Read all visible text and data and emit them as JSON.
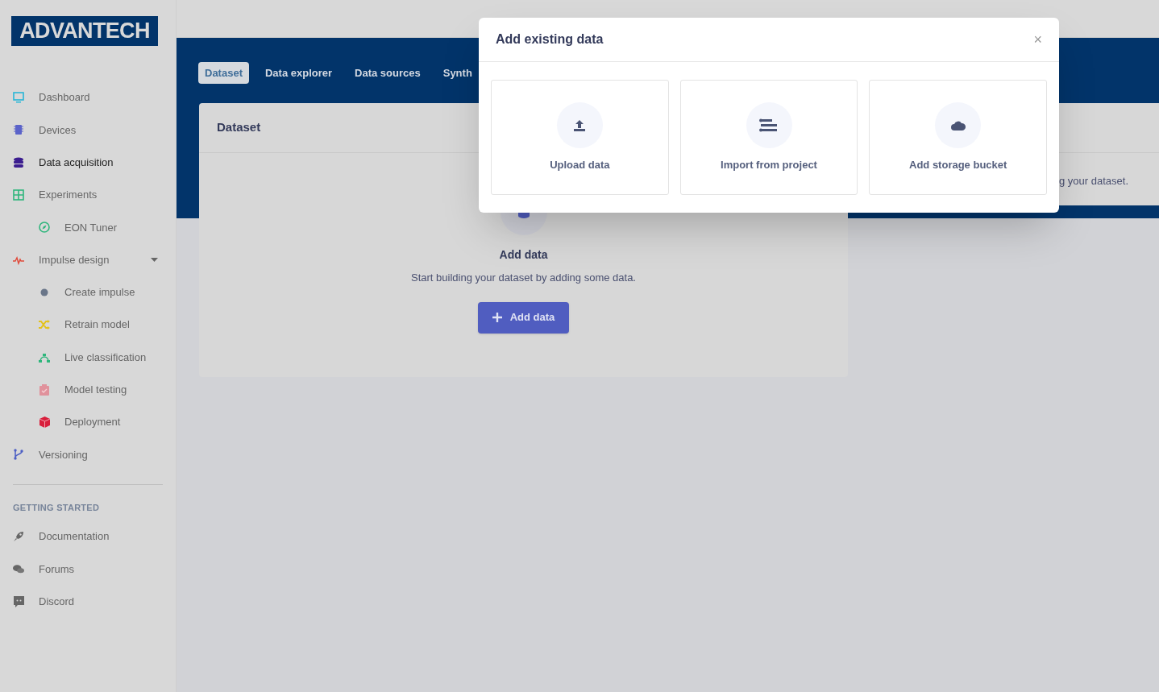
{
  "sidebar": {
    "logo": "ADVANTECH",
    "items": [
      {
        "label": "Dashboard",
        "kind": "main",
        "selected": false
      },
      {
        "label": "Devices",
        "kind": "main",
        "selected": false
      },
      {
        "label": "Data acquisition",
        "kind": "main",
        "selected": true
      },
      {
        "label": "Experiments",
        "kind": "main",
        "selected": false
      },
      {
        "label": "EON Tuner",
        "kind": "sub",
        "selected": false
      },
      {
        "label": "Impulse design",
        "kind": "main",
        "selected": false,
        "expanded": true
      },
      {
        "label": "Create impulse",
        "kind": "sub",
        "selected": false
      },
      {
        "label": "Retrain model",
        "kind": "sub",
        "selected": false
      },
      {
        "label": "Live classification",
        "kind": "sub",
        "selected": false
      },
      {
        "label": "Model testing",
        "kind": "sub",
        "selected": false
      },
      {
        "label": "Deployment",
        "kind": "sub",
        "selected": false
      },
      {
        "label": "Versioning",
        "kind": "main",
        "selected": false
      }
    ],
    "section_title": "GETTING STARTED",
    "links": [
      {
        "label": "Documentation"
      },
      {
        "label": "Forums"
      },
      {
        "label": "Discord"
      }
    ]
  },
  "tabs": [
    {
      "label": "Dataset",
      "selected": true
    },
    {
      "label": "Data explorer",
      "selected": false
    },
    {
      "label": "Data sources",
      "selected": false
    },
    {
      "label": "Synth",
      "selected": false
    }
  ],
  "dataset_card": {
    "title": "Dataset",
    "empty_title": "Add data",
    "empty_text": "Start building your dataset by adding some data.",
    "button": "Add data"
  },
  "side_card": {
    "text": "g your dataset."
  },
  "modal": {
    "title": "Add existing data",
    "close": "×",
    "options": [
      {
        "label": "Upload data"
      },
      {
        "label": "Import from project"
      },
      {
        "label": "Add storage bucket"
      }
    ]
  }
}
